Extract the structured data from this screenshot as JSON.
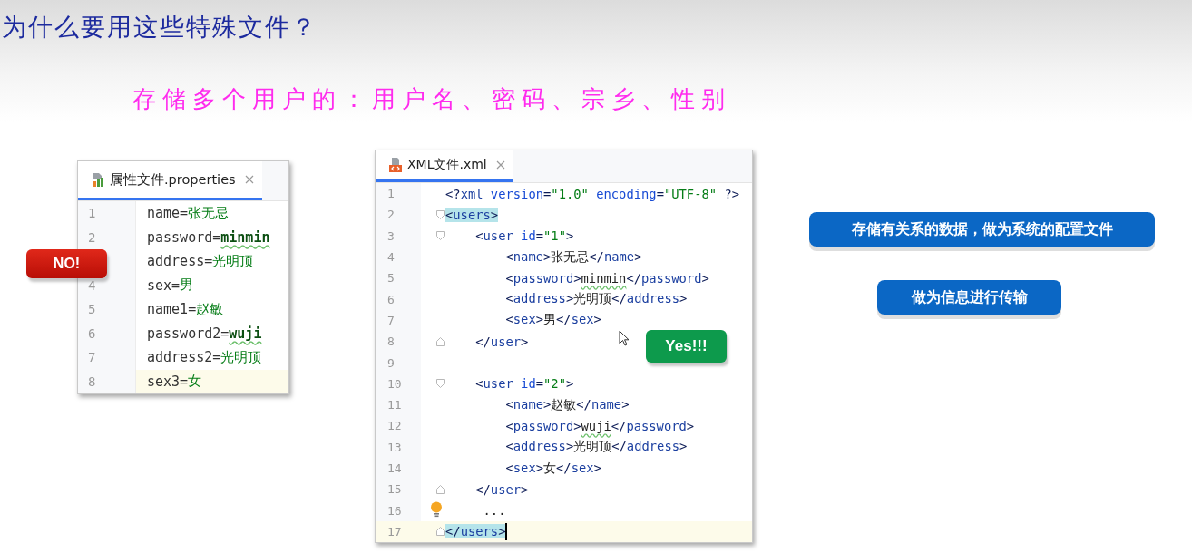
{
  "title": "为什么要用这些特殊文件？",
  "subtitle": "存储多个用户的：用户名、密码、宗乡、性别",
  "properties_editor": {
    "tab": {
      "label": "属性文件.properties",
      "selected": true
    },
    "lines": [
      {
        "number": "1",
        "key": "name=",
        "value": "张无忌",
        "typo": false,
        "current": false
      },
      {
        "number": "2",
        "key": "password=",
        "value": "minmin",
        "typo": true,
        "current": false
      },
      {
        "key": "address=",
        "value": "光明顶",
        "typo": false,
        "current": false
      },
      {
        "number": "4",
        "key": "sex=",
        "value": "男",
        "typo": false,
        "current": false
      },
      {
        "number": "5",
        "key": "name1=",
        "value": "赵敏",
        "typo": false,
        "current": false
      },
      {
        "number": "6",
        "key": "password2=",
        "value": "wuji",
        "typo": true,
        "current": false
      },
      {
        "number": "7",
        "key": "address2=",
        "value": "光明顶",
        "typo": false,
        "current": false
      },
      {
        "number": "8",
        "key": "sex3=",
        "value": "女",
        "typo": false,
        "current": true
      }
    ],
    "badge": "NO!"
  },
  "xml_editor": {
    "tab": {
      "label": "XML文件.xml",
      "selected": true
    },
    "lines": [
      {
        "number": "1",
        "kind": "plain",
        "current": false,
        "segments": [
          {
            "kind": "punct",
            "text": "<?"
          },
          {
            "kind": "tag",
            "text": "xml "
          },
          {
            "kind": "attr",
            "text": "version"
          },
          {
            "kind": "punct",
            "text": "="
          },
          {
            "kind": "value",
            "text": "\"1.0\" "
          },
          {
            "kind": "attr",
            "text": "encoding"
          },
          {
            "kind": "punct",
            "text": "="
          },
          {
            "kind": "value",
            "text": "\"UTF-8\" "
          },
          {
            "kind": "punct",
            "text": "?>"
          }
        ]
      },
      {
        "number": "2",
        "kind": "open",
        "current": false,
        "segments": [
          {
            "kind": "punct",
            "text": "<",
            "highlight": true
          },
          {
            "kind": "tag",
            "text": "users",
            "highlight": true
          },
          {
            "kind": "punct",
            "text": ">",
            "highlight": true
          }
        ]
      },
      {
        "number": "3",
        "kind": "open",
        "current": false,
        "segments": [
          {
            "kind": "punct",
            "text": "    <"
          },
          {
            "kind": "tag",
            "text": "user "
          },
          {
            "kind": "attr",
            "text": "id"
          },
          {
            "kind": "punct",
            "text": "="
          },
          {
            "kind": "value",
            "text": "\"1\""
          },
          {
            "kind": "punct",
            "text": ">"
          }
        ]
      },
      {
        "number": "4",
        "kind": "plain",
        "current": false,
        "segments": [
          {
            "kind": "punct",
            "text": "        <"
          },
          {
            "kind": "tag",
            "text": "name"
          },
          {
            "kind": "punct",
            "text": ">"
          },
          {
            "kind": "text",
            "text": "张无忌"
          },
          {
            "kind": "punct",
            "text": "</"
          },
          {
            "kind": "tag",
            "text": "name"
          },
          {
            "kind": "punct",
            "text": ">"
          }
        ]
      },
      {
        "number": "5",
        "kind": "plain",
        "current": false,
        "segments": [
          {
            "kind": "punct",
            "text": "        <"
          },
          {
            "kind": "tag",
            "text": "password"
          },
          {
            "kind": "punct",
            "text": ">"
          },
          {
            "kind": "text",
            "text": "minmin",
            "typo": true
          },
          {
            "kind": "punct",
            "text": "</"
          },
          {
            "kind": "tag",
            "text": "password"
          },
          {
            "kind": "punct",
            "text": ">"
          }
        ]
      },
      {
        "number": "6",
        "kind": "plain",
        "current": false,
        "segments": [
          {
            "kind": "punct",
            "text": "        <"
          },
          {
            "kind": "tag",
            "text": "address"
          },
          {
            "kind": "punct",
            "text": ">"
          },
          {
            "kind": "text",
            "text": "光明顶"
          },
          {
            "kind": "punct",
            "text": "</"
          },
          {
            "kind": "tag",
            "text": "address"
          },
          {
            "kind": "punct",
            "text": ">"
          }
        ]
      },
      {
        "number": "7",
        "kind": "plain",
        "current": false,
        "segments": [
          {
            "kind": "punct",
            "text": "        <"
          },
          {
            "kind": "tag",
            "text": "sex"
          },
          {
            "kind": "punct",
            "text": ">"
          },
          {
            "kind": "text",
            "text": "男"
          },
          {
            "kind": "punct",
            "text": "</"
          },
          {
            "kind": "tag",
            "text": "sex"
          },
          {
            "kind": "punct",
            "text": ">"
          }
        ]
      },
      {
        "number": "8",
        "kind": "close",
        "current": false,
        "segments": [
          {
            "kind": "punct",
            "text": "    </"
          },
          {
            "kind": "tag",
            "text": "user"
          },
          {
            "kind": "punct",
            "text": ">"
          }
        ]
      },
      {
        "number": "9",
        "kind": "plain",
        "current": false
      },
      {
        "number": "10",
        "kind": "open",
        "current": false,
        "segments": [
          {
            "kind": "punct",
            "text": "    <"
          },
          {
            "kind": "tag",
            "text": "user "
          },
          {
            "kind": "attr",
            "text": "id"
          },
          {
            "kind": "punct",
            "text": "="
          },
          {
            "kind": "value",
            "text": "\"2\""
          },
          {
            "kind": "punct",
            "text": ">"
          }
        ]
      },
      {
        "number": "11",
        "kind": "plain",
        "current": false,
        "segments": [
          {
            "kind": "punct",
            "text": "        <"
          },
          {
            "kind": "tag",
            "text": "name"
          },
          {
            "kind": "punct",
            "text": ">"
          },
          {
            "kind": "text",
            "text": "赵敏"
          },
          {
            "kind": "punct",
            "text": "</"
          },
          {
            "kind": "tag",
            "text": "name"
          },
          {
            "kind": "punct",
            "text": ">"
          }
        ]
      },
      {
        "number": "12",
        "kind": "plain",
        "current": false,
        "segments": [
          {
            "kind": "punct",
            "text": "        <"
          },
          {
            "kind": "tag",
            "text": "password"
          },
          {
            "kind": "punct",
            "text": ">"
          },
          {
            "kind": "text",
            "text": "wuji",
            "typo": true
          },
          {
            "kind": "punct",
            "text": "</"
          },
          {
            "kind": "tag",
            "text": "password"
          },
          {
            "kind": "punct",
            "text": ">"
          }
        ]
      },
      {
        "number": "13",
        "kind": "plain",
        "current": false,
        "segments": [
          {
            "kind": "punct",
            "text": "        <"
          },
          {
            "kind": "tag",
            "text": "address"
          },
          {
            "kind": "punct",
            "text": ">"
          },
          {
            "kind": "text",
            "text": "光明顶"
          },
          {
            "kind": "punct",
            "text": "</"
          },
          {
            "kind": "tag",
            "text": "address"
          },
          {
            "kind": "punct",
            "text": ">"
          }
        ]
      },
      {
        "number": "14",
        "kind": "plain",
        "current": false,
        "segments": [
          {
            "kind": "punct",
            "text": "        <"
          },
          {
            "kind": "tag",
            "text": "sex"
          },
          {
            "kind": "punct",
            "text": ">"
          },
          {
            "kind": "text",
            "text": "女"
          },
          {
            "kind": "punct",
            "text": "</"
          },
          {
            "kind": "tag",
            "text": "sex"
          },
          {
            "kind": "punct",
            "text": ">"
          }
        ]
      },
      {
        "number": "15",
        "kind": "close",
        "current": false,
        "segments": [
          {
            "kind": "punct",
            "text": "    </"
          },
          {
            "kind": "tag",
            "text": "user"
          },
          {
            "kind": "punct",
            "text": ">"
          }
        ]
      },
      {
        "number": "16",
        "kind": "plain",
        "current": false,
        "bulb": true,
        "segments": [
          {
            "kind": "text",
            "text": "     ..."
          }
        ]
      },
      {
        "number": "17",
        "kind": "close",
        "current": true,
        "segments": [
          {
            "kind": "punct",
            "text": "</",
            "highlight": true
          },
          {
            "kind": "tag",
            "text": "users",
            "highlight": true
          },
          {
            "kind": "punct",
            "text": ">",
            "highlight": true
          }
        ]
      }
    ],
    "badge": "Yes!!!"
  },
  "callouts": [
    "存储有关系的数据，做为系统的配置文件",
    "做为信息进行传输"
  ]
}
